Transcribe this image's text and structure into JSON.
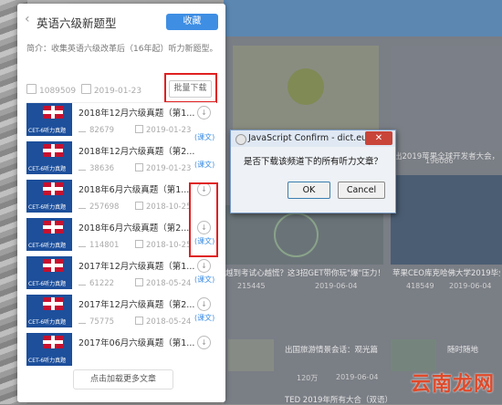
{
  "panel": {
    "title": "英语六级新题型",
    "collect_label": "收藏",
    "intro": "简介：收集英语六级改革后（16年起）听力新题型。",
    "plays": "1089509",
    "date": "2019-01-23",
    "batch_download_label": "批量下载",
    "load_more_label": "点击加载更多文章",
    "thumb_caption": "CET-6听力真题",
    "transcript_label": "(课文)",
    "download_icon": "↓",
    "items": [
      {
        "title": "2018年12月六级真题（第1...",
        "plays": "82679",
        "date": "2019-01-23"
      },
      {
        "title": "2018年12月六级真题（第2...",
        "plays": "38636",
        "date": "2019-01-23"
      },
      {
        "title": "2018年6月六级真题（第1...",
        "plays": "257698",
        "date": "2018-10-25"
      },
      {
        "title": "2018年6月六级真题（第2...",
        "plays": "114801",
        "date": "2018-10-25"
      },
      {
        "title": "2017年12月六级真题（第1...",
        "plays": "61222",
        "date": "2018-05-24"
      },
      {
        "title": "2017年12月六级真题（第2...",
        "plays": "75775",
        "date": "2018-05-24"
      },
      {
        "title": "2017年06月六级真题（第1...",
        "plays": "",
        "date": ""
      }
    ]
  },
  "dialog": {
    "title": "JavaScript Confirm - dict.eudi...",
    "close_label": "✕",
    "message": "是否下载该频道下的所有听力文章？",
    "ok_label": "OK",
    "cancel_label": "Cancel"
  },
  "background": {
    "card1": {
      "title": "",
      "plays": "",
      "date": ""
    },
    "card2": {
      "title": "出2019苹果全球开发者大会，",
      "plays": "196086",
      "date": ""
    },
    "card3": {
      "title": "越到考试心越慌？这3招GET带你玩\"爆\"压力！",
      "plays": "215445",
      "date": "2019-06-04"
    },
    "card4": {
      "title": "苹果CEO库克哈佛大学2019毕业",
      "plays": "418549",
      "date": "2019-06-04"
    },
    "bottom1": {
      "title": "出国旅游情景会话：观光篇",
      "plays": "120万",
      "date": "2019-06-04"
    },
    "bottom2": {
      "title": "随时随地",
      "plays": "",
      "date": ""
    },
    "bottom3": "TED 2019年所有大合（双语）",
    "watermark": "云南龙网"
  }
}
